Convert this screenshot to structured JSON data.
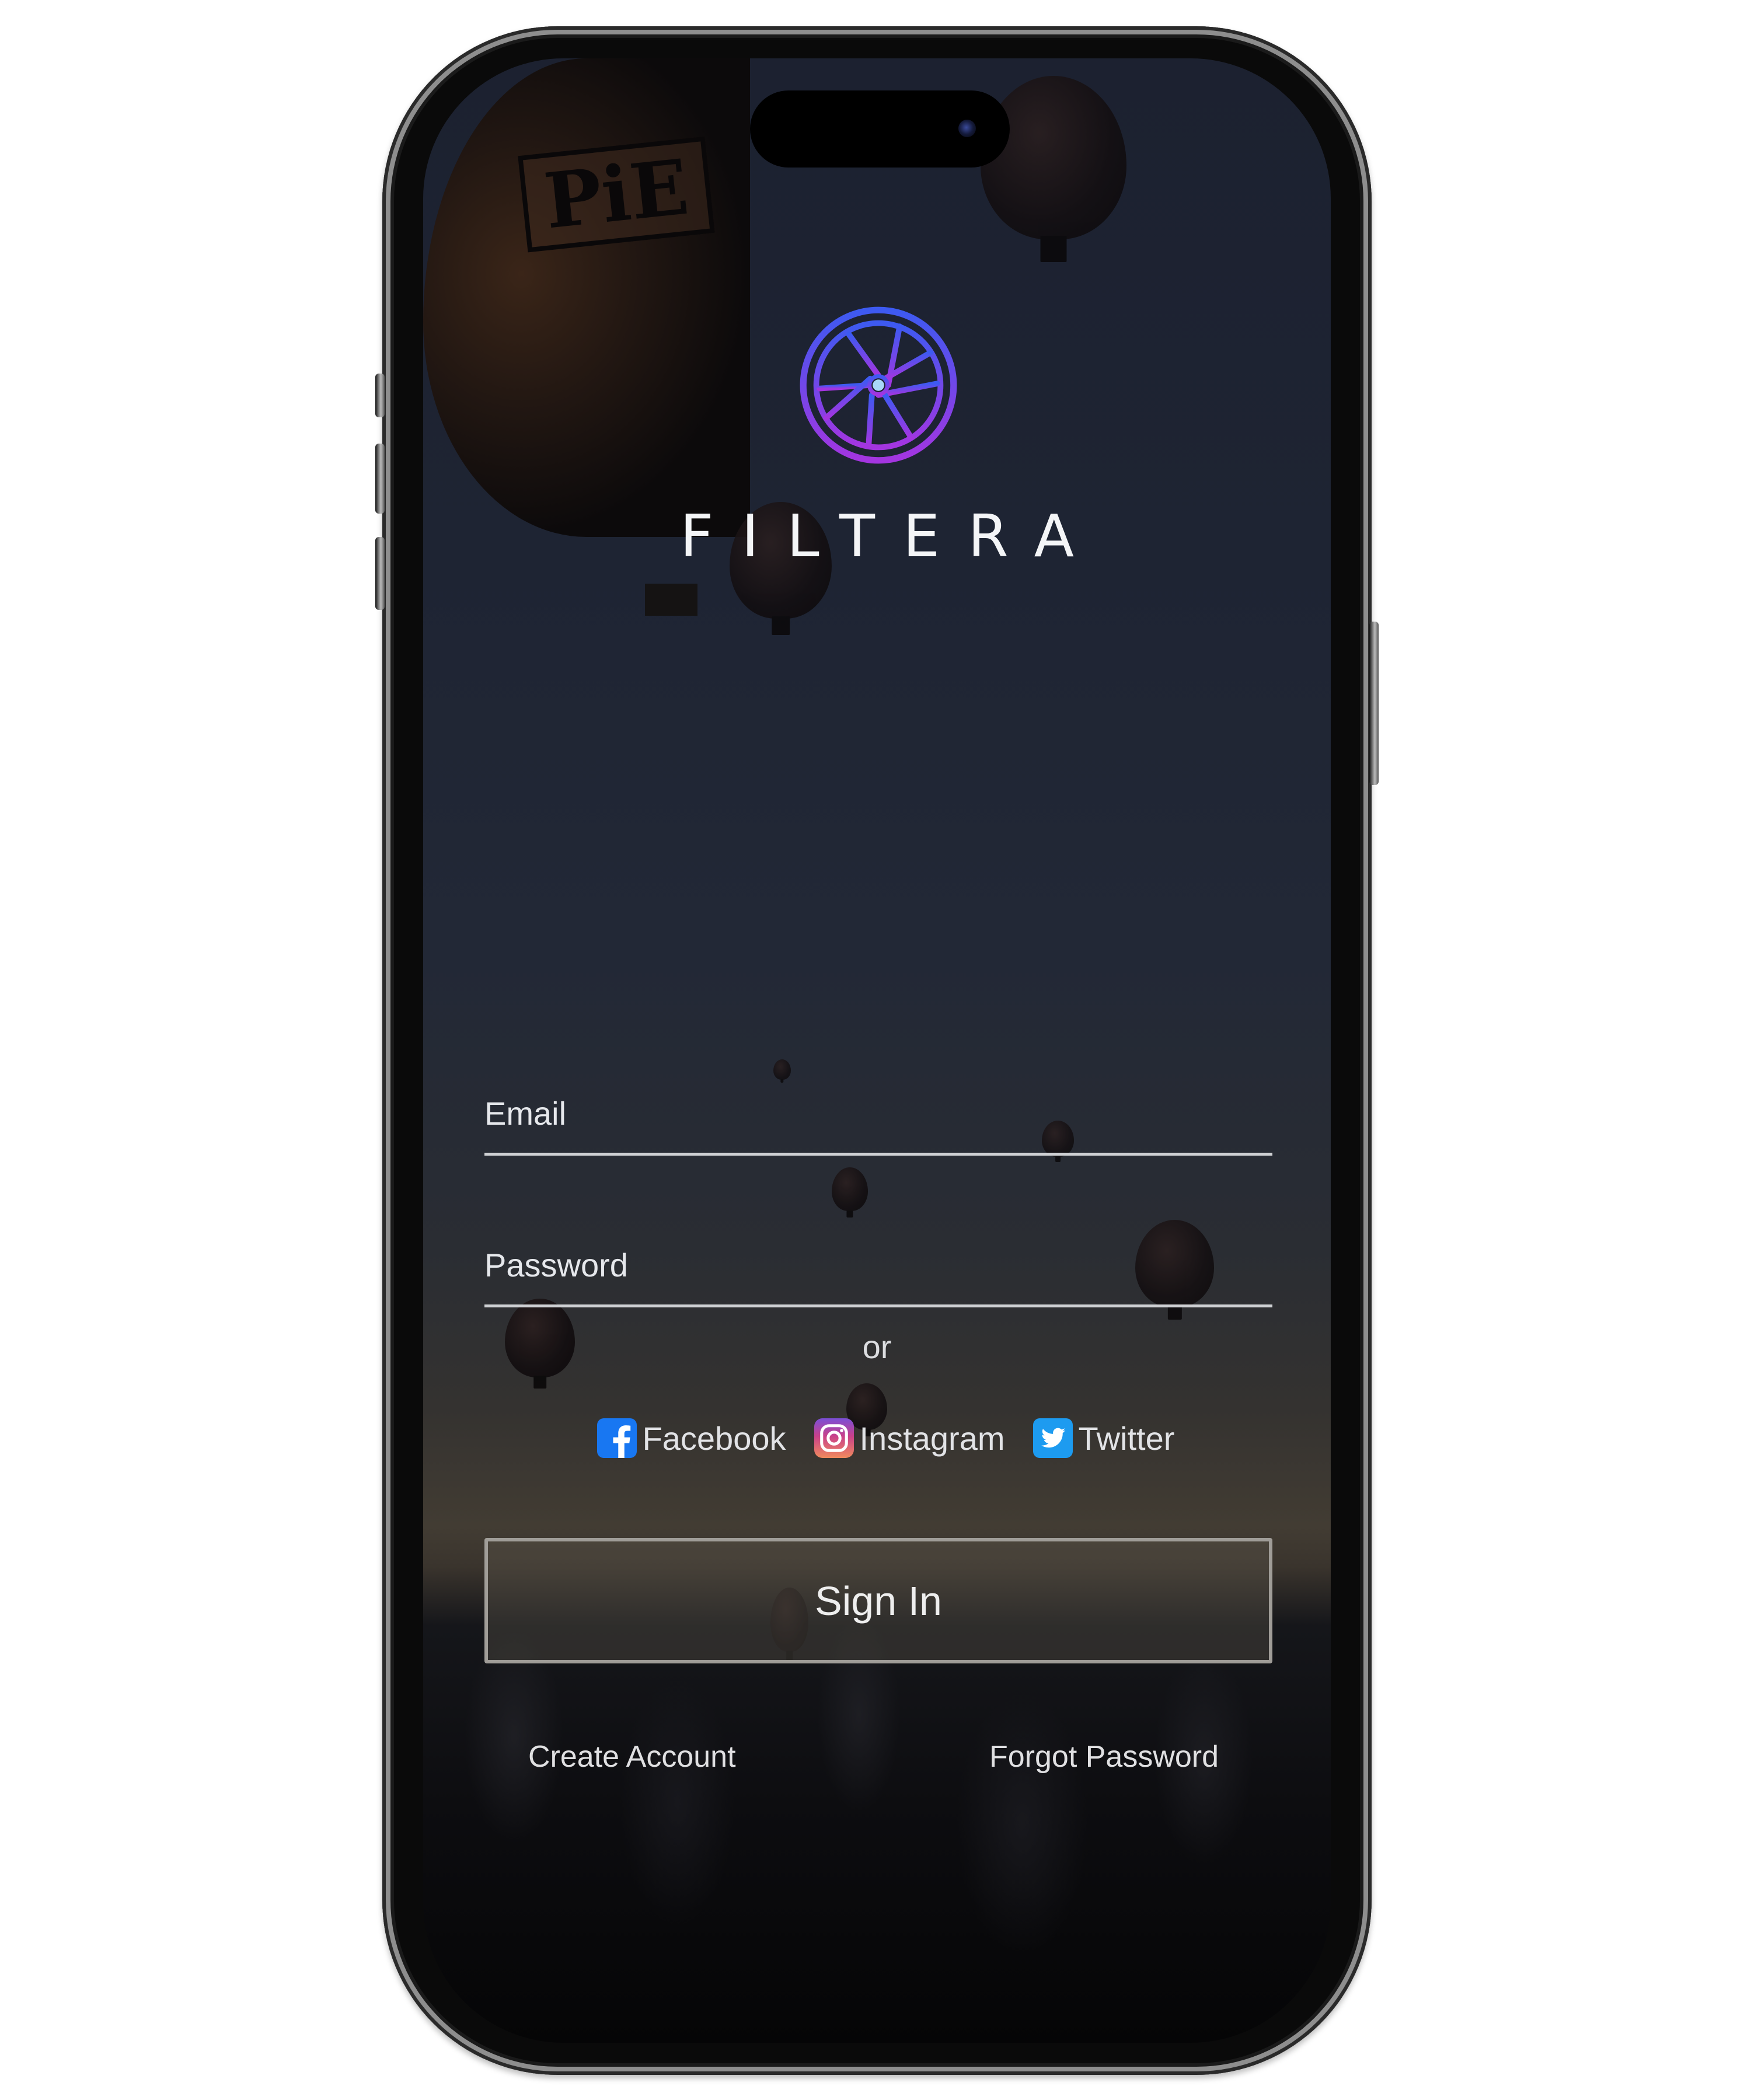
{
  "device": {
    "type": "smartphone mockup",
    "frame_color": "#0a0a0a"
  },
  "app": {
    "name": "FILTERA",
    "logo_icon": "camera-aperture-icon",
    "logo_gradient": [
      "#3d5af1",
      "#a435e0"
    ],
    "logo_center_color": "#a8d8f8"
  },
  "background": {
    "description": "Hot air balloons at dusk over rocky valley",
    "balloon_marking": "PiE"
  },
  "form": {
    "email_label": "Email",
    "email_value": "",
    "password_label": "Password",
    "password_value": ""
  },
  "divider_text": "or",
  "social": [
    {
      "name": "facebook",
      "label": "Facebook",
      "icon": "facebook-icon",
      "color": "#1877f2"
    },
    {
      "name": "instagram",
      "label": "Instagram",
      "icon": "instagram-icon",
      "color": "#e1306c"
    },
    {
      "name": "twitter",
      "label": "Twitter",
      "icon": "twitter-icon",
      "color": "#1d9bf0"
    }
  ],
  "actions": {
    "sign_in_label": "Sign In",
    "create_account_label": "Create Account",
    "forgot_password_label": "Forgot Password"
  }
}
